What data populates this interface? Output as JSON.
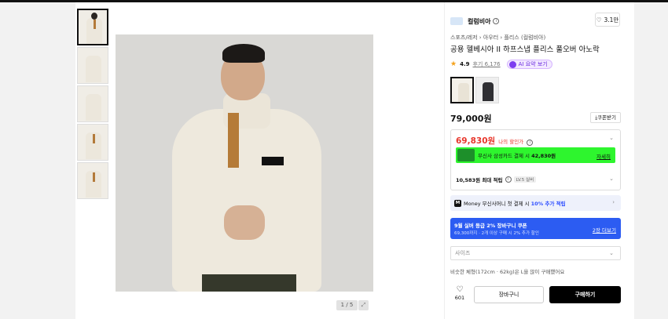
{
  "gallery": {
    "thumbnail_count": 5,
    "counter": "1 / 5"
  },
  "brand": {
    "name": "컬럼비아",
    "like_count": "3.1만"
  },
  "product": {
    "breadcrumb": [
      "스포츠/레저",
      "아우터",
      "플리스 (컬럼비아)"
    ],
    "title": "공용 헬베시아 II 하프스냅 플리스 풀오버 아노락",
    "rating": "4.9",
    "reviews": "후기 6,176",
    "ai_summary": "AI 요약 보기",
    "price": "79,000원",
    "coupon_button": "쿠폰받기"
  },
  "benefit": {
    "discount_price": "69,830원",
    "discount_label": "나의 할인가",
    "card_text": "무신사 삼성카드 결제 시",
    "card_price": "42,830원",
    "card_apply": "자세히",
    "points": "10,583원 최대 적립",
    "level": "LV.5 실버"
  },
  "money": {
    "icon": "M",
    "text": "Money 무신사머니 첫 결제 시",
    "highlight": "10% 추가 적립"
  },
  "coupon_banner": {
    "title": "9월 실버 등급 2% 장바구니 쿠폰",
    "subtitle": "69,300까지 · 2개 이상 구매 시 2% 추가 할인",
    "more": "2장 더보기"
  },
  "size": {
    "placeholder": "사이즈"
  },
  "similar": "비슷한 체형(172cm · 62kg)은 L을 많이 구매했어요",
  "actions": {
    "wish_count": "601",
    "cart": "장바구니",
    "buy": "구매하기"
  },
  "colors": {
    "discount_red": "#e8372c",
    "card_banner_green": "#2ef52e",
    "coupon_blue": "#2c5cf2",
    "star": "#f4a21d"
  }
}
